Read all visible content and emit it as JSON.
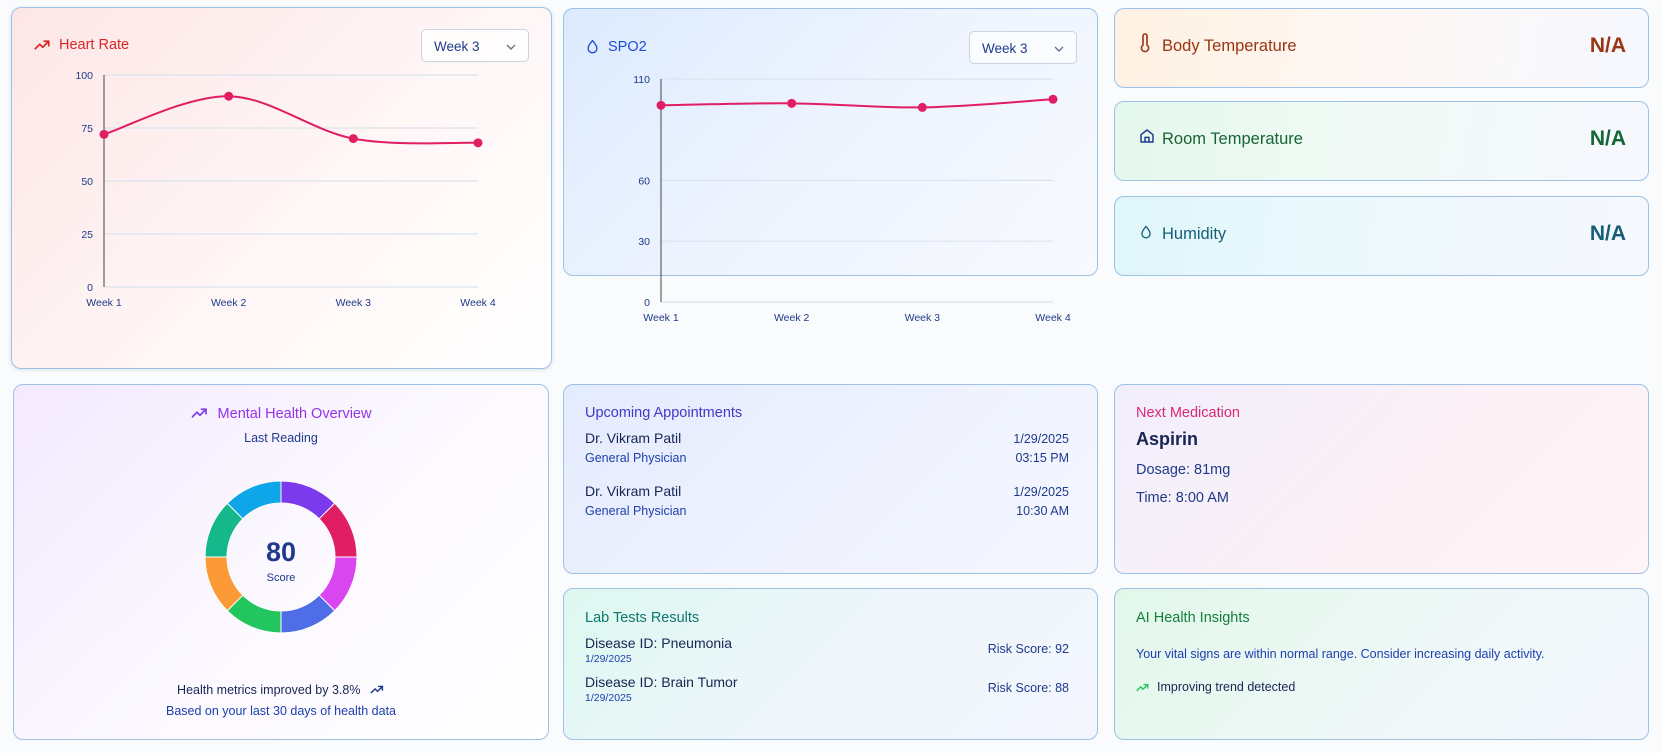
{
  "heart_rate": {
    "title": "Heart Rate",
    "icon": "trending-up-icon",
    "dropdown_value": "Week 3",
    "chart_data": {
      "type": "line",
      "title": "Heart Rate",
      "categories": [
        "Week 1",
        "Week 2",
        "Week 3",
        "Week 4"
      ],
      "values": [
        72,
        90,
        70,
        68
      ],
      "yticks": [
        "0",
        "25",
        "50",
        "75",
        "100"
      ],
      "ylim": [
        0,
        100
      ],
      "line_color": "#e11d63",
      "grid": true
    }
  },
  "spo2": {
    "title": "SPO2",
    "icon": "droplet-icon",
    "dropdown_value": "Week 3",
    "chart_data": {
      "type": "line",
      "title": "SPO2",
      "categories": [
        "Week 1",
        "Week 2",
        "Week 3",
        "Week 4"
      ],
      "values": [
        97,
        98,
        96,
        100
      ],
      "yticks": [
        "0",
        "30",
        "60",
        "110"
      ],
      "ylim": [
        0,
        110
      ],
      "line_color": "#e11d63",
      "grid": true
    }
  },
  "body_temp": {
    "label": "Body Temperature",
    "value": "N/A",
    "icon": "thermometer-icon",
    "color": "#9a3412"
  },
  "room_temp": {
    "label": "Room Temperature",
    "value": "N/A",
    "icon": "home-icon",
    "color": "#166534"
  },
  "humidity": {
    "label": "Humidity",
    "value": "N/A",
    "icon": "droplet-icon",
    "color": "#155e75"
  },
  "mental": {
    "title": "Mental Health Overview",
    "subtitle": "Last Reading",
    "score": "80",
    "score_label": "Score",
    "improved_text": "Health metrics improved by 3.8%",
    "footnote": "Based on your last 30 days of health data",
    "chart_data": {
      "type": "pie",
      "values": [
        1,
        1,
        1,
        1,
        1,
        1,
        1,
        1
      ],
      "colors": [
        "#7c3aed",
        "#e11d63",
        "#d946ef",
        "#4f6de6",
        "#22c55e",
        "#fb9a37",
        "#14b88a",
        "#0ea5e9"
      ]
    }
  },
  "appointments": {
    "title": "Upcoming Appointments",
    "items": [
      {
        "doctor": "Dr. Vikram Patil",
        "specialty": "General Physician",
        "date": "1/29/2025",
        "time": "03:15 PM"
      },
      {
        "doctor": "Dr. Vikram Patil",
        "specialty": "General Physician",
        "date": "1/29/2025",
        "time": "10:30 AM"
      }
    ]
  },
  "medication": {
    "title": "Next Medication",
    "name": "Aspirin",
    "dosage": "Dosage: 81mg",
    "time": "Time: 8:00 AM"
  },
  "lab": {
    "title": "Lab Tests Results",
    "items": [
      {
        "disease": "Disease ID: Pneumonia",
        "date": "1/29/2025",
        "risk": "Risk Score: 92"
      },
      {
        "disease": "Disease ID: Brain Tumor",
        "date": "1/29/2025",
        "risk": "Risk Score: 88"
      }
    ]
  },
  "insights": {
    "title": "AI Health Insights",
    "text": "Your vital signs are within normal range. Consider increasing daily activity.",
    "trend": "Improving trend detected"
  }
}
